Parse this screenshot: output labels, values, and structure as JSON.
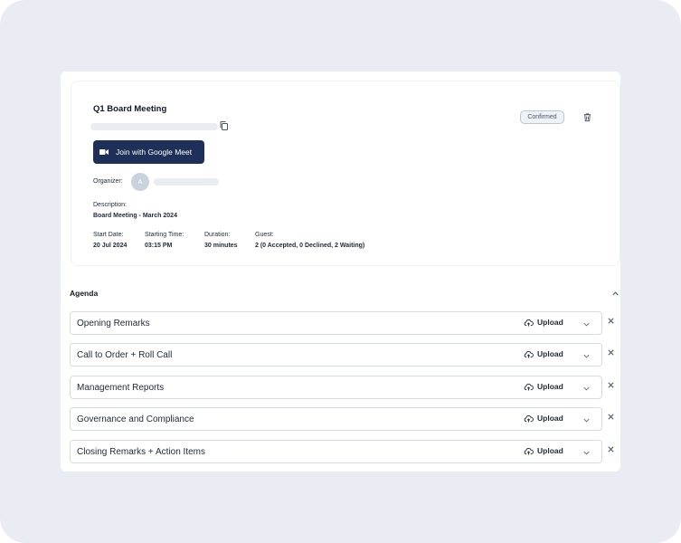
{
  "meeting": {
    "title": "Q1 Board Meeting",
    "status": "Confirmed",
    "join_label": "Join with Google Meet",
    "organizer_label": "Organizer:",
    "organizer_initial": "A",
    "description_label": "Description:",
    "description_value": "Board Meeting - March 2024",
    "start_date_label": "Start Date:",
    "start_date_value": "20 Jul 2024",
    "start_time_label": "Starting Time:",
    "start_time_value": "03:15 PM",
    "duration_label": "Duration:",
    "duration_value": "30 minutes",
    "guest_label": "Guest:",
    "guest_value": "2 (0 Accepted, 0 Declined, 2 Waiting)"
  },
  "agenda": {
    "title": "Agenda",
    "upload_label": "Upload",
    "items": [
      {
        "label": "Opening Remarks"
      },
      {
        "label": "Call to Order + Roll Call"
      },
      {
        "label": "Management Reports"
      },
      {
        "label": "Governance and Compliance"
      },
      {
        "label": "Closing Remarks + Action Items"
      }
    ]
  },
  "icons": {
    "copy": "copy-icon",
    "trash": "trash-icon",
    "video": "video-camera-icon",
    "collapse": "chevron-up-icon",
    "upload": "cloud-upload-icon",
    "expand": "chevron-down-icon",
    "remove": "close-icon"
  },
  "colors": {
    "primary": "#1e2f58",
    "background": "#e9edf3",
    "badge_border": "#bcc6d3"
  }
}
